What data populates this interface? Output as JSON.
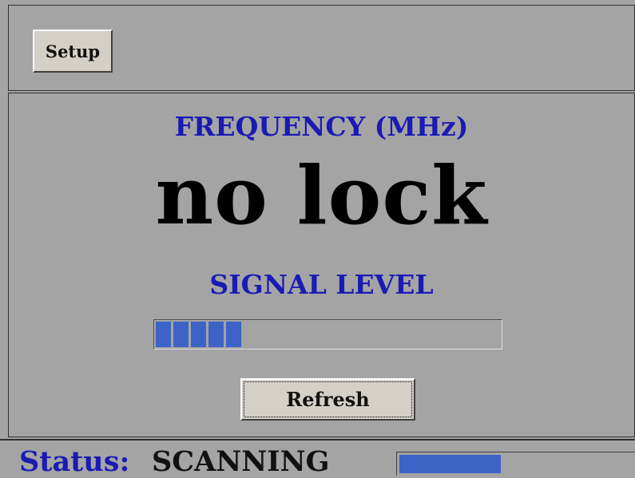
{
  "toolbar": {
    "setup_label": "Setup"
  },
  "main": {
    "frequency_label": "FREQUENCY (MHz)",
    "frequency_value": "no lock",
    "signal_label": "SIGNAL LEVEL",
    "signal_level_fraction": 0.24,
    "signal_segments_lit": 5,
    "refresh_label": "Refresh"
  },
  "status": {
    "label": "Status:",
    "value": "SCANNING",
    "progress_fraction": 0.43
  },
  "colors": {
    "background": "#a4a4a4",
    "heading": "#1a1ab4",
    "bar_fill": "#3d63c7"
  }
}
